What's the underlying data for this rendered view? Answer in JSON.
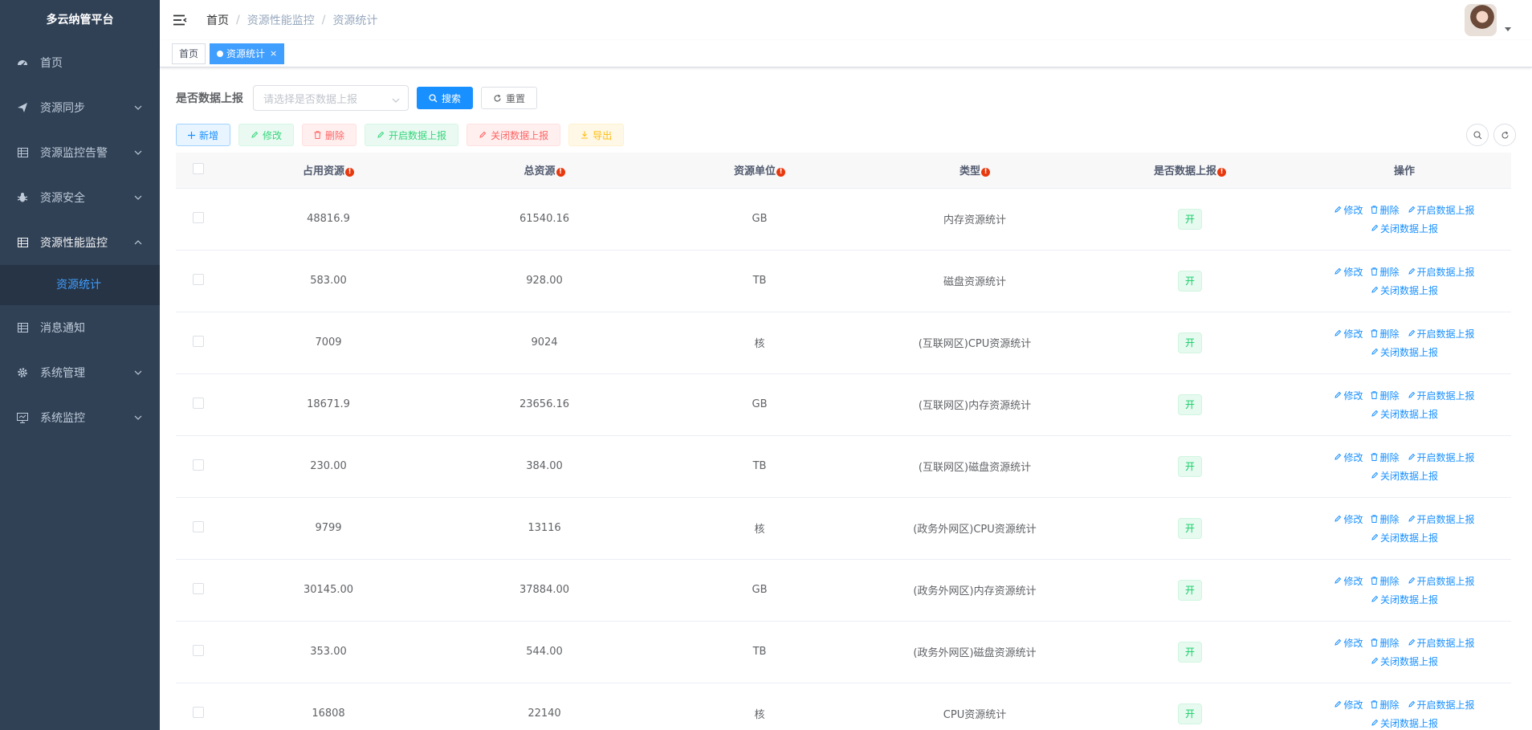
{
  "app": {
    "title": "多云纳管平台"
  },
  "sidebar": {
    "items": [
      {
        "label": "首页",
        "icon": "dashboard-icon"
      },
      {
        "label": "资源同步",
        "icon": "send-icon"
      },
      {
        "label": "资源监控告警",
        "icon": "table-icon"
      },
      {
        "label": "资源安全",
        "icon": "bug-icon"
      },
      {
        "label": "资源性能监控",
        "icon": "table-icon",
        "sub": [
          {
            "label": "资源统计"
          }
        ]
      },
      {
        "label": "消息通知",
        "icon": "table-icon"
      },
      {
        "label": "系统管理",
        "icon": "gear-icon"
      },
      {
        "label": "系统监控",
        "icon": "monitor-icon"
      }
    ]
  },
  "breadcrumb": [
    "首页",
    "资源性能监控",
    "资源统计"
  ],
  "tags": [
    {
      "label": "首页"
    },
    {
      "label": "资源统计",
      "close": "×"
    }
  ],
  "search": {
    "label": "是否数据上报",
    "placeholder": "请选择是否数据上报",
    "search_label": "搜索",
    "reset_label": "重置"
  },
  "toolbar": {
    "add": "新增",
    "edit": "修改",
    "delete": "删除",
    "enable": "开启数据上报",
    "disable": "关闭数据上报",
    "export": "导出"
  },
  "table": {
    "headers": [
      "占用资源",
      "总资源",
      "资源单位",
      "类型",
      "是否数据上报",
      "操作"
    ],
    "ops": {
      "edit": "修改",
      "delete": "删除",
      "enable": "开启数据上报",
      "disable": "关闭数据上报"
    },
    "rows": [
      {
        "used": "48816.9",
        "total": "61540.16",
        "unit": "GB",
        "type": "内存资源统计",
        "report": "开"
      },
      {
        "used": "583.00",
        "total": "928.00",
        "unit": "TB",
        "type": "磁盘资源统计",
        "report": "开"
      },
      {
        "used": "7009",
        "total": "9024",
        "unit": "核",
        "type": "(互联网区)CPU资源统计",
        "report": "开"
      },
      {
        "used": "18671.9",
        "total": "23656.16",
        "unit": "GB",
        "type": "(互联网区)内存资源统计",
        "report": "开"
      },
      {
        "used": "230.00",
        "total": "384.00",
        "unit": "TB",
        "type": "(互联网区)磁盘资源统计",
        "report": "开"
      },
      {
        "used": "9799",
        "total": "13116",
        "unit": "核",
        "type": "(政务外网区)CPU资源统计",
        "report": "开"
      },
      {
        "used": "30145.00",
        "total": "37884.00",
        "unit": "GB",
        "type": "(政务外网区)内存资源统计",
        "report": "开"
      },
      {
        "used": "353.00",
        "total": "544.00",
        "unit": "TB",
        "type": "(政务外网区)磁盘资源统计",
        "report": "开"
      },
      {
        "used": "16808",
        "total": "22140",
        "unit": "核",
        "type": "CPU资源统计",
        "report": "开"
      }
    ]
  },
  "colors": {
    "sidebar_bg": "#304156",
    "primary": "#1890ff",
    "active_sub": "#409eff",
    "success": "#13ce66",
    "danger": "#ff4949",
    "warning": "#ffba00"
  }
}
